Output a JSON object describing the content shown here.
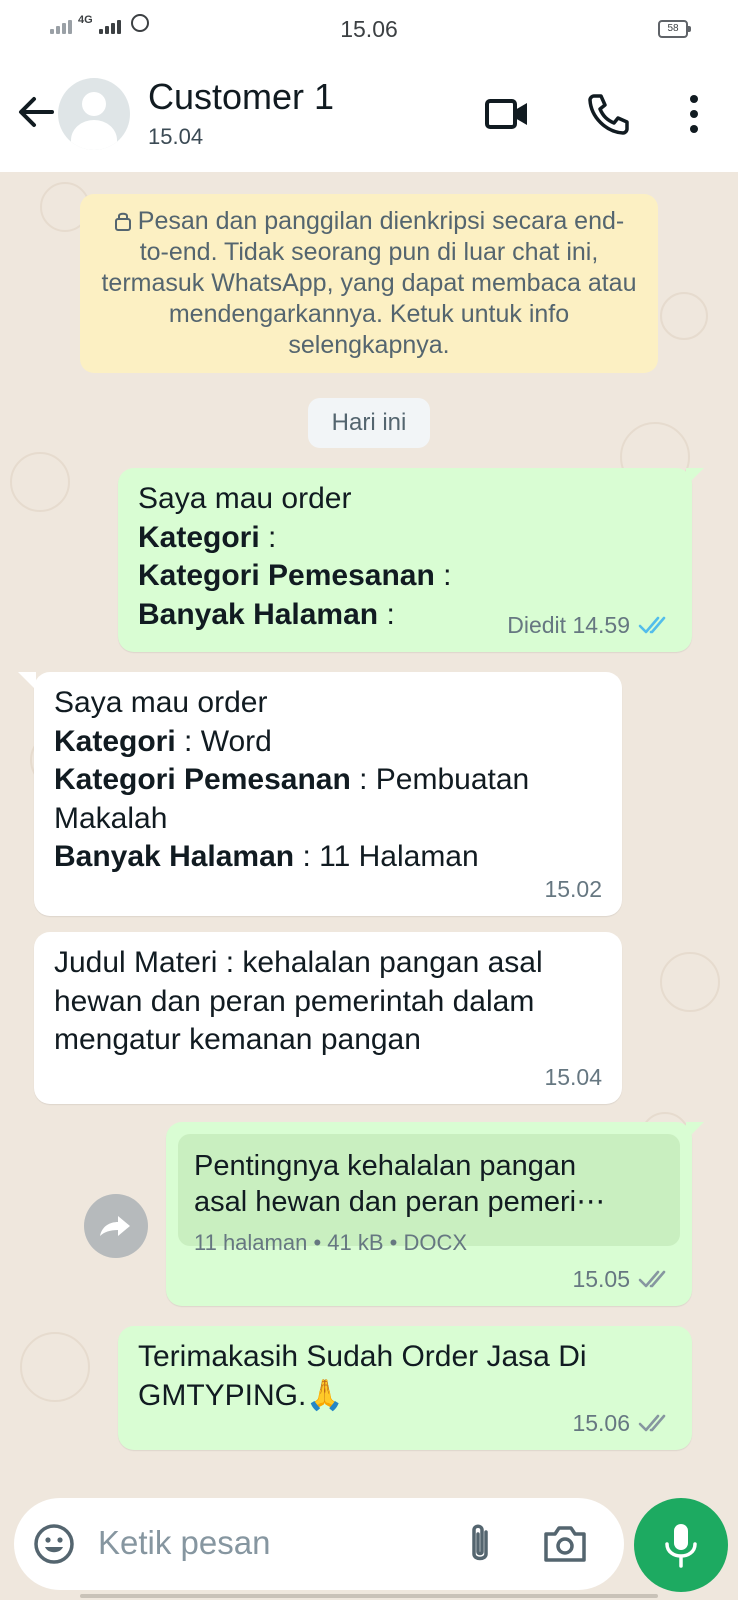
{
  "status_bar": {
    "network": "4G",
    "time": "15.06",
    "battery": "58"
  },
  "header": {
    "contact_name": "Customer 1",
    "last_seen": "15.04"
  },
  "encryption_notice": "Pesan dan panggilan dienkripsi secara end-to-end. Tidak seorang pun di luar chat ini, termasuk WhatsApp, yang dapat membaca atau mendengarkannya. Ketuk untuk info selengkapnya.",
  "date_chip": "Hari ini",
  "messages": [
    {
      "direction": "outgoing",
      "line1": "Saya mau order",
      "kategori_label": "Kategori",
      "kategori_value": "",
      "pemesanan_label": "Kategori Pemesanan",
      "pemesanan_value": "",
      "halaman_label": "Banyak Halaman",
      "halaman_value": "",
      "meta": "Diedit 14.59",
      "status": "read"
    },
    {
      "direction": "incoming",
      "line1": "Saya mau order",
      "kategori_label": "Kategori",
      "kategori_value": "Word",
      "pemesanan_label": "Kategori Pemesanan",
      "pemesanan_value": "Pembuatan Makalah",
      "halaman_label": "Banyak Halaman",
      "halaman_value": "11 Halaman",
      "meta": "15.02"
    },
    {
      "direction": "incoming",
      "text": "Judul Materi : kehalalan pangan asal hewan dan peran pemerintah dalam mengatur kemanan pangan",
      "meta": "15.04"
    },
    {
      "direction": "outgoing",
      "document": {
        "title_line1": "Pentingnya kehalalan pangan",
        "title_line2": "asal hewan dan peran pemeri⋯",
        "info": "11 halaman • 41 kB • DOCX"
      },
      "meta": "15.05",
      "status": "delivered"
    },
    {
      "direction": "outgoing",
      "text_line1": "Terimakasih Sudah Order Jasa Di",
      "text_line2": "GMTYPING.",
      "emoji": "🙏",
      "meta": "15.06",
      "status": "delivered"
    }
  ],
  "input": {
    "placeholder": "Ketik pesan"
  },
  "colors": {
    "outgoing_bubble": "#d9fdd3",
    "incoming_bubble": "#ffffff",
    "chat_background": "#efe7dd",
    "read_ticks": "#53bdeb",
    "mic_button": "#1daa61"
  }
}
